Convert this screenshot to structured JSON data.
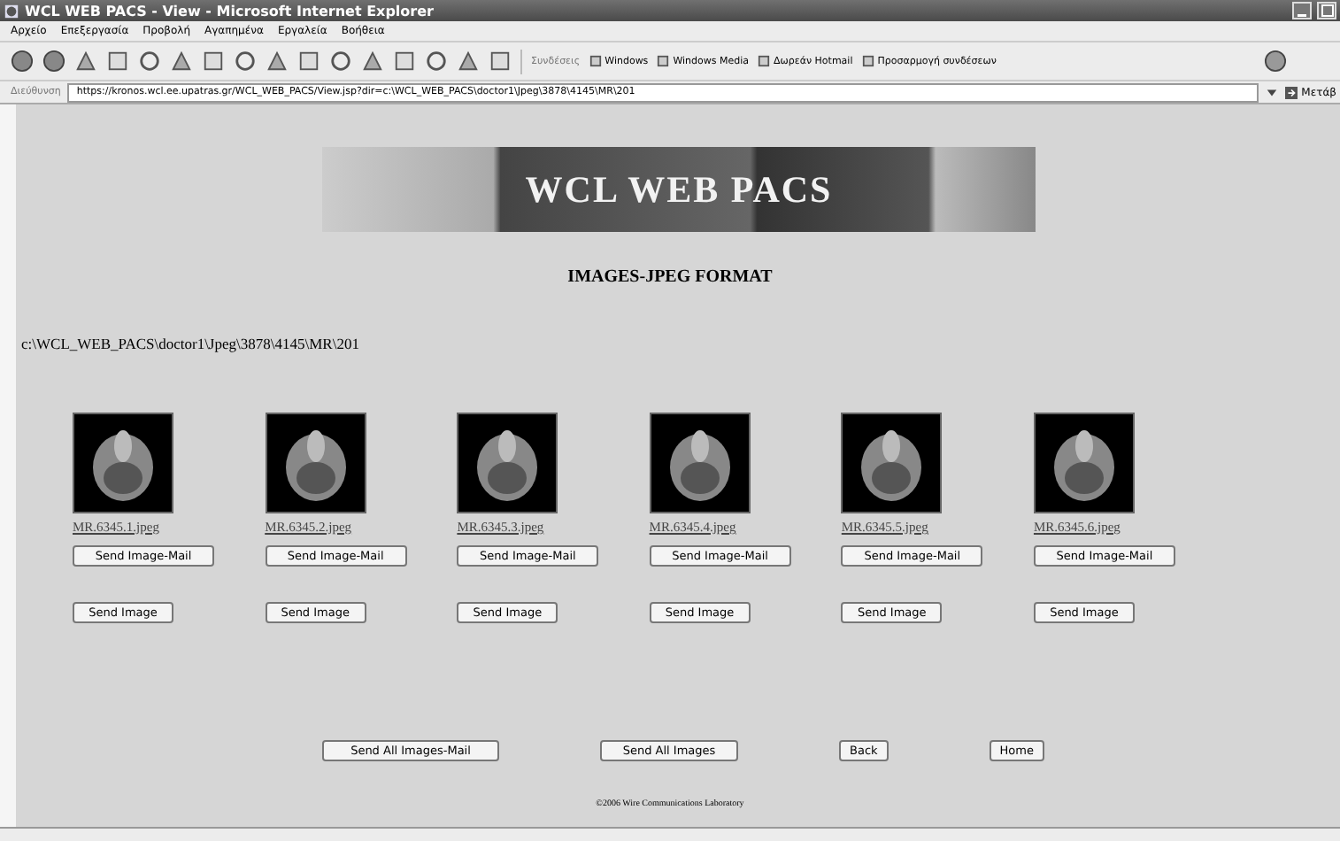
{
  "window": {
    "title": "WCL WEB PACS - View - Microsoft Internet Explorer"
  },
  "menu": [
    "Αρχείο",
    "Επεξεργασία",
    "Προβολή",
    "Αγαπημένα",
    "Εργαλεία",
    "Βοήθεια"
  ],
  "links_bar": {
    "label": "Συνδέσεις",
    "links": [
      "Windows",
      "Windows Media",
      "Δωρεάν Hotmail",
      "Προσαρμογή συνδέσεων"
    ]
  },
  "address_bar": {
    "label": "Διεύθυνση",
    "url": "https://kronos.wcl.ee.upatras.gr/WCL_WEB_PACS/View.jsp?dir=c:\\WCL_WEB_PACS\\doctor1\\Jpeg\\3878\\4145\\MR\\201",
    "go": "Μετάβ"
  },
  "page": {
    "banner_title": "WCL WEB PACS",
    "heading": "IMAGES-JPEG FORMAT",
    "path": "c:\\WCL_WEB_PACS\\doctor1\\Jpeg\\3878\\4145\\MR\\201",
    "images": [
      {
        "filename": "MR.6345.1.jpeg",
        "mail_button": "Send Image-Mail",
        "send_button": "Send Image"
      },
      {
        "filename": "MR.6345.2.jpeg",
        "mail_button": "Send Image-Mail",
        "send_button": "Send Image"
      },
      {
        "filename": "MR.6345.3.jpeg",
        "mail_button": "Send Image-Mail",
        "send_button": "Send Image"
      },
      {
        "filename": "MR.6345.4.jpeg",
        "mail_button": "Send Image-Mail",
        "send_button": "Send Image"
      },
      {
        "filename": "MR.6345.5.jpeg",
        "mail_button": "Send Image-Mail",
        "send_button": "Send Image"
      },
      {
        "filename": "MR.6345.6.jpeg",
        "mail_button": "Send Image-Mail",
        "send_button": "Send Image"
      }
    ],
    "actions": [
      "Send All Images-Mail",
      "Send All Images",
      "Back",
      "Home"
    ],
    "footer": "©2006 Wire Communications Laboratory"
  }
}
